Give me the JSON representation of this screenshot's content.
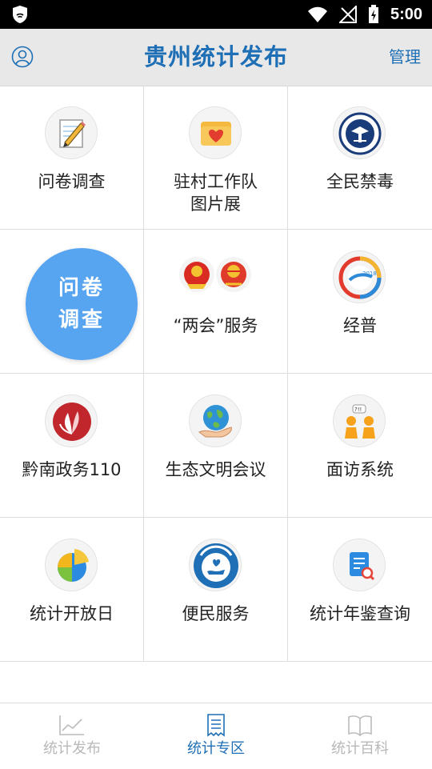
{
  "status_bar": {
    "time": "5:00"
  },
  "header": {
    "title": "贵州统计发布",
    "manage_label": "管理"
  },
  "grid": {
    "items": [
      {
        "label": "问卷调查",
        "icon": "pencil-notepad-icon"
      },
      {
        "label": "驻村工作队\n图片展",
        "icon": "heart-folder-icon"
      },
      {
        "label": "全民禁毒",
        "icon": "anti-drug-emblem-icon"
      },
      {
        "label": "",
        "icon": ""
      },
      {
        "label": "“两会”服务",
        "icon": "national-emblems-icon"
      },
      {
        "label": "经普",
        "icon": "census-2018-logo-icon"
      },
      {
        "label": "黔南政务110",
        "icon": "leaf-logo-icon"
      },
      {
        "label": "生态文明会议",
        "icon": "earth-hand-icon"
      },
      {
        "label": "面访系统",
        "icon": "interview-people-icon"
      },
      {
        "label": "统计开放日",
        "icon": "pie-chart-icon"
      },
      {
        "label": "便民服务",
        "icon": "service-heart-hand-icon"
      },
      {
        "label": "统计年鉴查询",
        "icon": "yearbook-search-icon"
      }
    ]
  },
  "floating_button": {
    "line1": "问卷",
    "line2": "调查"
  },
  "tabs": [
    {
      "label": "统计发布",
      "icon": "line-chart-icon",
      "active": false
    },
    {
      "label": "统计专区",
      "icon": "document-list-icon",
      "active": true
    },
    {
      "label": "统计百科",
      "icon": "open-book-icon",
      "active": false
    }
  ],
  "colors": {
    "accent": "#1e6fb5",
    "float_button": "#57a4f1",
    "header_bg": "#e8e8e8"
  }
}
